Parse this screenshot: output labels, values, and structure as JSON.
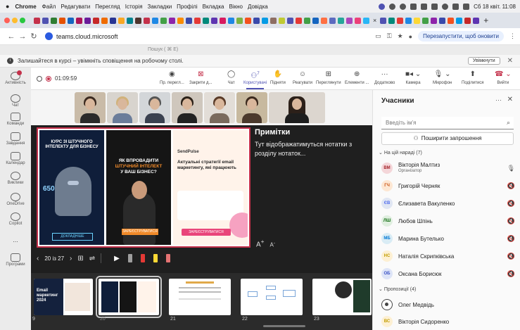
{
  "menubar": {
    "app": "Chrome",
    "items": [
      "Файл",
      "Редагувати",
      "Перегляд",
      "Історія",
      "Закладки",
      "Профілі",
      "Вкладка",
      "Вікно",
      "Довідка"
    ],
    "datetime": "Сб 18 квіт. 11:08"
  },
  "browser": {
    "url": "teams.cloud.microsoft",
    "relaunch": "Перезапустити, щоб оновити"
  },
  "teams": {
    "search_placeholder": "Пошук ( ⌘ E)"
  },
  "notification": {
    "text": "Залишайтеся в курсі – увімкніть сповіщення на робочому столі.",
    "enable": "Увімкнути"
  },
  "rail": {
    "items": [
      "Активність",
      "Чат",
      "Команди",
      "Завдання",
      "Календар",
      "Виклики",
      "OneDrive",
      "Copilot",
      "...",
      "Програми"
    ]
  },
  "meeting": {
    "timer": "01:09:59",
    "tools": [
      {
        "label": "Пр. перегл...",
        "icon": "eye-icon"
      },
      {
        "label": "Закрити д...",
        "icon": "close-share-icon"
      },
      {
        "label": "Чат",
        "icon": "chat-icon"
      },
      {
        "label": "Користувачі",
        "icon": "people-icon",
        "count": "7"
      },
      {
        "label": "Підняти",
        "icon": "raise-hand-icon"
      },
      {
        "label": "Реагувати",
        "icon": "react-icon"
      },
      {
        "label": "Переглянути",
        "icon": "view-icon"
      },
      {
        "label": "Елементи ...",
        "icon": "apps-icon"
      },
      {
        "label": "Додатково",
        "icon": "more-icon"
      },
      {
        "label": "Камера",
        "icon": "camera-icon"
      },
      {
        "label": "Мікрофон",
        "icon": "mic-icon"
      },
      {
        "label": "Поділитися",
        "icon": "share-icon"
      },
      {
        "label": "Вийти",
        "icon": "leave-icon"
      }
    ]
  },
  "slide": {
    "poster1_title": "КУРС ЗІ ШТУЧНОГО ІНТЕЛЕКТУ ДЛЯ БІЗНЕСУ",
    "poster1_number": "650",
    "poster1_cta": "ДОКЛАДНІШЕ",
    "poster2_title_a": "ЯК ВПРОВАДИТИ",
    "poster2_title_b": "ШТУЧНИЙ ІНТЕЛЕКТ",
    "poster2_title_c": "У ВАШ БІЗНЕС?",
    "poster2_cta": "ЗАРЕЄСТРУВАТИСЯ",
    "poster3_brand": "SendPulse",
    "poster3_title": "Актуальні стратегії email маркетингу, які працюють",
    "poster3_cta": "ЗАРЕЄСТРУВАТИСЯ"
  },
  "notes": {
    "title": "Примітки",
    "body": "Тут відображатимуться нотатки з розділу нотаток..."
  },
  "slidenav": {
    "position": "20 із 27"
  },
  "thumbnails": [
    {
      "num": "9",
      "title": "Email маркетинг 2024"
    },
    {
      "num": "20",
      "title": ""
    },
    {
      "num": "21",
      "title": ""
    },
    {
      "num": "22",
      "title": ""
    },
    {
      "num": "23",
      "title": ""
    }
  ],
  "participants": {
    "title": "Учасники",
    "search_placeholder": "Введіть ім'я",
    "share_label": "Поширити запрошення",
    "in_meeting_label": "На цій нараді (7)",
    "suggested_label": "Пропозиції (4)",
    "in_meeting": [
      {
        "initials": "ВМ",
        "name": "Вікторія Малтиз",
        "role": "Організатор",
        "bg": "#f4d6d9",
        "fg": "#a4262c"
      },
      {
        "initials": "ГЧ",
        "name": "Григорій Черняк",
        "role": "",
        "bg": "#fde7d3",
        "fg": "#ca5010"
      },
      {
        "initials": "ЄВ",
        "name": "Єлизавета Вакуленко",
        "role": "",
        "bg": "#e0e6f3",
        "fg": "#4f6bed"
      },
      {
        "initials": "ЛШ",
        "name": "Любов Шпінь",
        "role": "",
        "bg": "#e0efe0",
        "fg": "#0b6a0b"
      },
      {
        "initials": "МБ",
        "name": "Марина Бутелько",
        "role": "",
        "bg": "#d9ecf5",
        "fg": "#0078d4"
      },
      {
        "initials": "НС",
        "name": "Наталія Скрипківська",
        "role": "",
        "bg": "#fdf0d3",
        "fg": "#c19c00"
      },
      {
        "initials": "ОБ",
        "name": "Оксана Борисюк",
        "role": "",
        "bg": "#dde4f7",
        "fg": "#3a51c4"
      }
    ],
    "suggested": [
      {
        "initials": "",
        "name": "Олег Медвідь"
      },
      {
        "initials": "ВС",
        "name": "Вікторія Сидоренко",
        "bg": "#fdf0d3",
        "fg": "#c19c00"
      }
    ]
  },
  "colors": {
    "accent": "#4f52b2",
    "leave": "#c4314b"
  }
}
